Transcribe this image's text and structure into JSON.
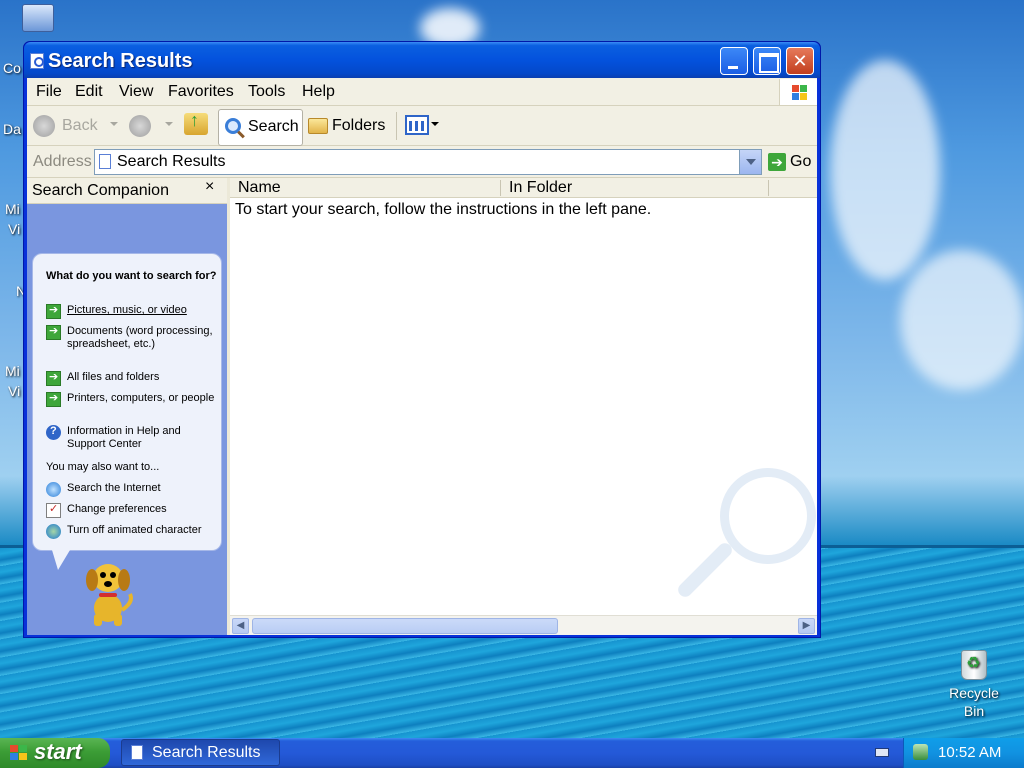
{
  "desktop": {
    "partial_icon_labels": [
      "Co",
      "Da",
      "Mi",
      "Vi",
      "N",
      "Mi",
      "Vi"
    ],
    "recycle_bin_label": "Recycle Bin"
  },
  "window": {
    "title": "Search Results",
    "menu": [
      "File",
      "Edit",
      "View",
      "Favorites",
      "Tools",
      "Help"
    ],
    "toolbar": {
      "back_label": "Back",
      "search_label": "Search",
      "folders_label": "Folders"
    },
    "address": {
      "label": "Address",
      "value": "Search Results",
      "go_label": "Go"
    }
  },
  "search_companion": {
    "title": "Search Companion",
    "close_glyph": "×",
    "question": "What do you want to search for?",
    "options": [
      "Pictures, music, or video",
      "Documents (word processing, spreadsheet, etc.)",
      "All files and folders",
      "Printers, computers, or people",
      "Information in Help and Support Center"
    ],
    "also_label": "You may also want to...",
    "also_options": [
      "Search the Internet",
      "Change preferences",
      "Turn off animated character"
    ]
  },
  "results": {
    "columns": [
      "Name",
      "In Folder"
    ],
    "instructions": "To start your search, follow the instructions in the left pane."
  },
  "taskbar": {
    "start_label": "start",
    "task_title": "Search Results",
    "clock": "10:52 AM"
  },
  "colors": {
    "titlebar_blue": "#0452dd",
    "companion_blue": "#7a96df",
    "start_green": "#3c9d36",
    "close_red": "#c23e1d"
  },
  "icons": [
    "computer-icon",
    "xp-flag-icon",
    "back-icon",
    "forward-icon",
    "up-folder-icon",
    "search-icon",
    "folders-icon",
    "views-icon",
    "go-icon",
    "green-arrow-icon",
    "help-icon",
    "internet-search-icon",
    "preferences-icon",
    "animated-character-icon",
    "dog-character",
    "recycle-bin-icon",
    "keyboard-icon",
    "tray-network-icon"
  ]
}
